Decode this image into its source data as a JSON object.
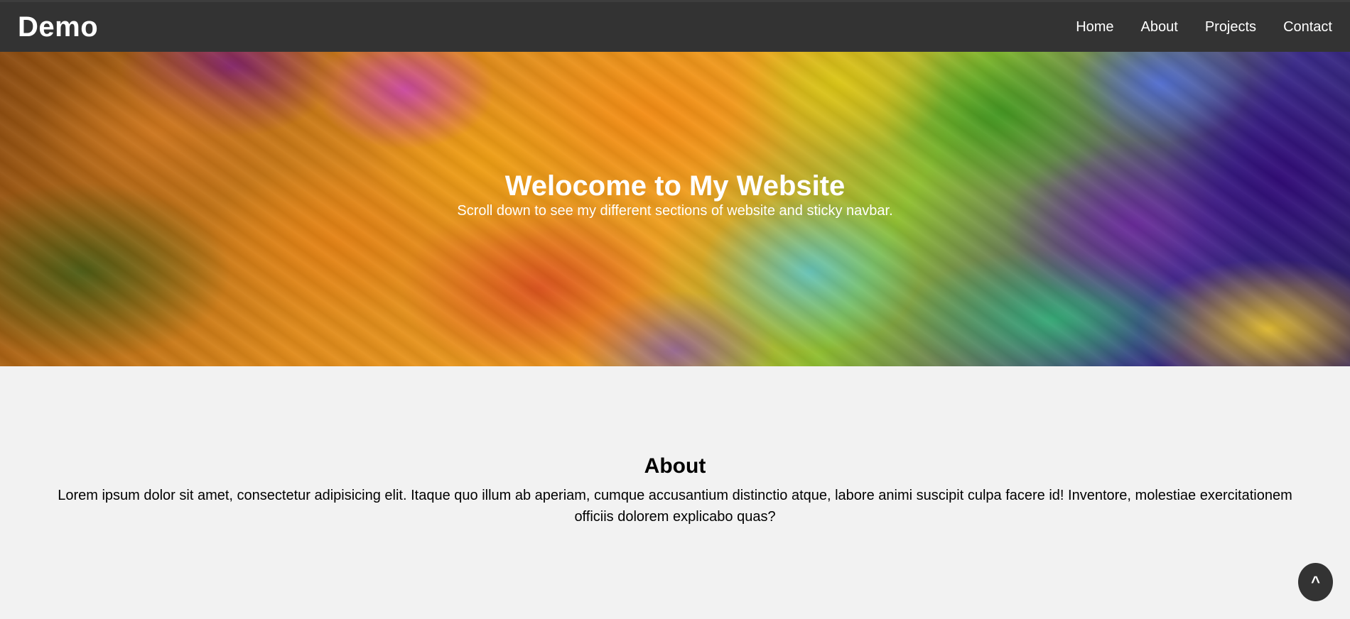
{
  "navbar": {
    "brand": "Demo",
    "links": [
      "Home",
      "About",
      "Projects",
      "Contact"
    ]
  },
  "hero": {
    "title": "Welocome to My Website",
    "subtitle": "Scroll down to see my different sections of website and sticky navbar."
  },
  "about": {
    "title": "About",
    "text": "Lorem ipsum dolor sit amet, consectetur adipisicing elit. Itaque quo illum ab aperiam, cumque accusantium distinctio atque, labore animi suscipit culpa facere id! Inventore, molestiae exercitationem officiis dolorem explicabo quas?"
  },
  "scroll_top_button": {
    "label": "^"
  },
  "colors": {
    "navbar_bg": "#333333",
    "page_bg": "#f2f2f2",
    "text_light": "#ffffff",
    "text_dark": "#000000"
  }
}
